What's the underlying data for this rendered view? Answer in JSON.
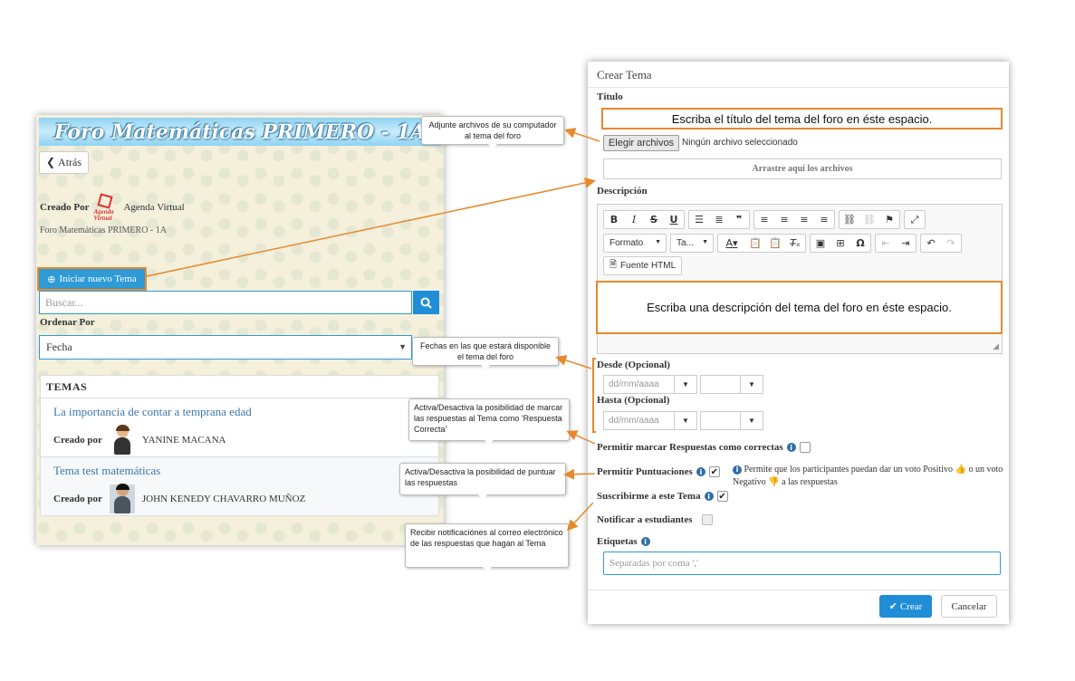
{
  "forum": {
    "banner": "Foro Matemáticas PRIMERO - 1A",
    "back_label": "Atrás",
    "created_by_label": "Creado Por",
    "creator_name": "Agenda Virtual",
    "logo_text": "Agenda Virtual",
    "subtitle": "Foro Matemáticas PRIMERO - 1A",
    "new_topic_label": "Iniciar nuevo Tema",
    "search_placeholder": "Buscar...",
    "order_label": "Ordenar Por",
    "order_value": "Fecha",
    "topics_heading": "TEMAS",
    "topics": [
      {
        "title": "La importancia de contar a temprana edad",
        "by_label": "Creado por",
        "author": "YANINE MACANA"
      },
      {
        "title": "Tema test matemáticas",
        "by_label": "Creado por",
        "author": "JOHN KENEDY CHAVARRO MUÑOZ"
      }
    ]
  },
  "modal": {
    "title": "Crear Tema",
    "title_label": "Título",
    "title_value": "Escriba el título del tema del foro en éste espacio.",
    "file_button": "Elegir archivos",
    "file_status": "Ningún archivo seleccionado",
    "dropzone": "Arrastre aquí los archivos",
    "description_label": "Descripción",
    "toolbar": {
      "format_label": "Formato",
      "size_label": "Ta...",
      "source_label": "Fuente HTML"
    },
    "description_value": "Escriba una descripción del tema del foro en éste espacio.",
    "from_label": "Desde (Opcional)",
    "to_label": "Hasta (Opcional)",
    "date_placeholder": "dd/mm/aaaa",
    "allow_correct_label": "Permitir marcar Respuestas como correctas",
    "allow_scores_label": "Permitir Puntuaciones",
    "scores_hint_a": "Permite que los participantes puedan dar un voto Positivo",
    "scores_hint_b": "o",
    "scores_hint_c": "un voto Negativo",
    "scores_hint_d": "a las respuestas",
    "subscribe_label": "Suscribirme a este Tema",
    "notify_label": "Notificar a estudiantes",
    "tags_label": "Etiquetas",
    "tags_placeholder": "Separadas por coma ','",
    "create_label": "Crear",
    "cancel_label": "Cancelar"
  },
  "callouts": {
    "attach": "Adjunte archivos de su computador al tema del foro",
    "dates": "Fechas en las que estará disponible el tema del foro",
    "correct": "Activa/Desactiva la posibilidad de marcar las respuestas al Tema como 'Respuesta Correcta'",
    "scores": "Activa/Desactiva la posibilidad de puntuar las respuestas",
    "notify": "Recibir notificaciónes al correo electrónico de las respuestas que hagan al Tema"
  },
  "state": {
    "allow_correct": false,
    "allow_scores": true,
    "subscribe": true,
    "notify": false
  },
  "colors": {
    "accent": "#1f8ed6",
    "highlight": "#e7892c"
  }
}
